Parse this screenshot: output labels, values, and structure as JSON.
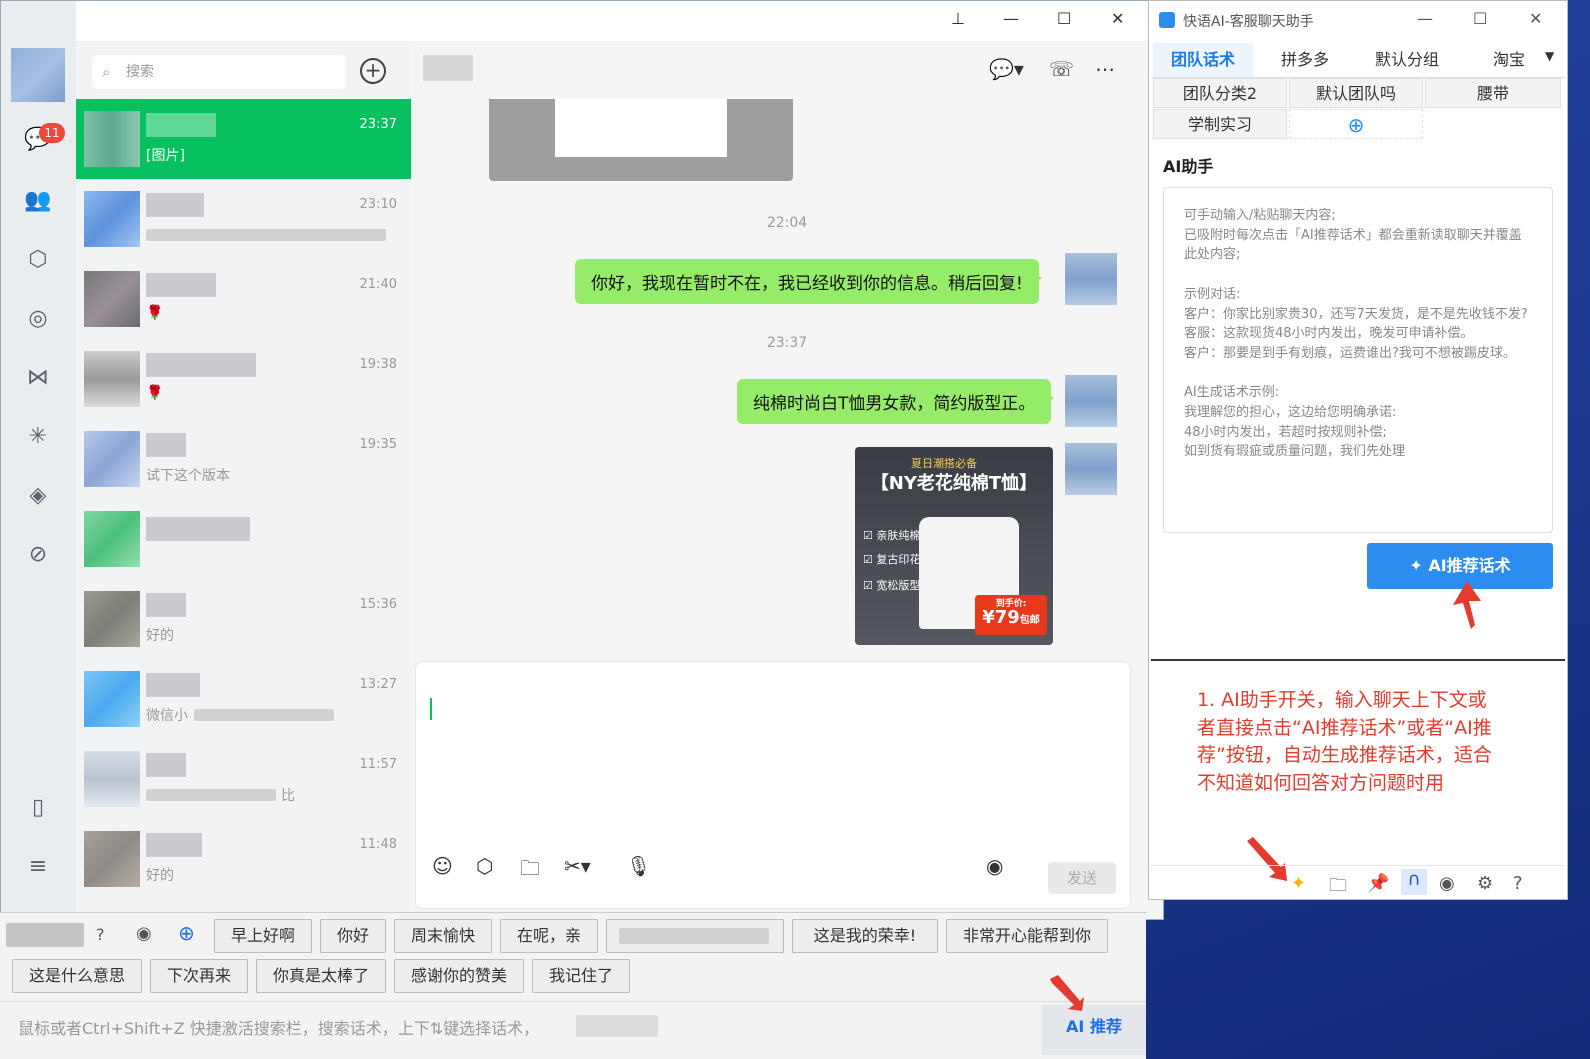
{
  "chat_window": {
    "badge_count": "11",
    "search_placeholder": "搜索",
    "conversations": [
      {
        "time": "23:37",
        "preview": "[图片]"
      },
      {
        "time": "23:10",
        "preview": ""
      },
      {
        "time": "21:40",
        "preview": "🌹"
      },
      {
        "time": "19:38",
        "preview": "🌹"
      },
      {
        "time": "19:35",
        "preview": "试下这个版本"
      },
      {
        "time": "",
        "preview": ""
      },
      {
        "time": "15:36",
        "preview": "好的"
      },
      {
        "time": "13:27",
        "preview": "微信小"
      },
      {
        "time": "11:57",
        "preview": "比"
      },
      {
        "time": "11:48",
        "preview": "好的"
      }
    ],
    "timestamps": [
      "22:04",
      "23:37"
    ],
    "messages": [
      "你好，我现在暂时不在，我已经收到你的信息。稍后回复!",
      "纯棉时尚白T恤男女款，简约版型正。"
    ],
    "image_message": {
      "banner": "夏日潮搭必备",
      "title": "【NY老花纯棉T恤】",
      "tags": [
        "亲肤纯棉",
        "复古印花",
        "宽松版型"
      ],
      "price_label": "到手价:",
      "price": "¥79",
      "price_note": "包邮"
    },
    "send_label": "发送"
  },
  "phrase_bar": {
    "row1": [
      "早上好啊",
      "你好",
      "周末愉快",
      "在呢，亲",
      "这是我的荣幸!",
      "非常开心能帮到你"
    ],
    "row2": [
      "这是什么意思",
      "下次再来",
      "你真是太棒了",
      "感谢你的赞美",
      "我记住了"
    ],
    "hint": "鼠标或者Ctrl+Shift+Z 快捷激活搜索栏，搜索话术，上下⇅键选择话术，",
    "ai_button": "AI 推荐"
  },
  "assistant": {
    "title": "快语AI-客服聊天助手",
    "tabs": [
      "团队话术",
      "拼多多",
      "默认分组",
      "淘宝"
    ],
    "categories": [
      "团队分类2",
      "默认团队吗",
      "腰带",
      "学制实习"
    ],
    "ai_heading": "AI助手",
    "ai_text": "可手动输入/粘贴聊天内容;\n已吸附时每次点击「AI推荐话术」都会重新读取聊天并覆盖此处内容;\n\n示例对话:\n客户：你家比别家贵30，还写7天发货，是不是先收钱不发?\n客服：这款现货48小时内发出，晚发可申请补偿。\n客户：那要是到手有划痕，运费谁出?我可不想被踢皮球。\n\nAI生成话术示例:\n我理解您的担心，这边给您明确承诺:\n48小时内发出，若超时按规则补偿;\n如到货有瑕疵或质量问题，我们先处理",
    "ai_button": "AI推荐话术",
    "annotation": "1. AI助手开关，输入聊天上下文或者直接点击“AI推荐话术”或者“AI推荐”按钮，自动生成推荐话术，适合不知道如何回答对方问题时用"
  }
}
